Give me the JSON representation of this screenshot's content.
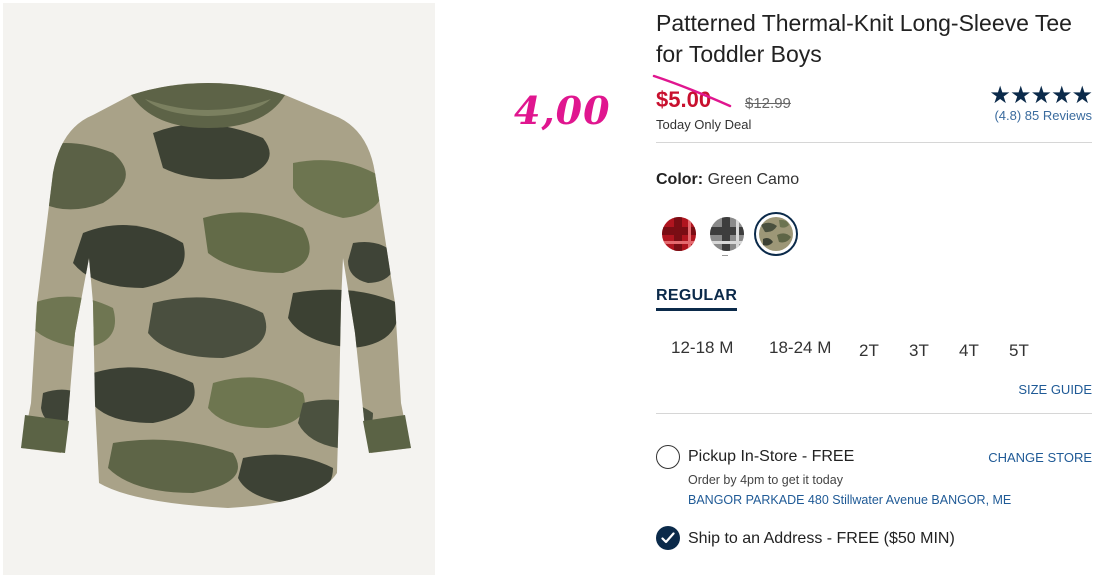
{
  "annotation": {
    "handwritten_price": "4,00"
  },
  "product": {
    "title": "Patterned Thermal-Knit Long-Sleeve Tee for Toddler Boys",
    "sale_price": "$5.00",
    "original_price": "$12.99",
    "deal_label": "Today Only Deal",
    "rating_stars": "★★★★★",
    "rating_value": "(4.8)",
    "review_count": "85 Reviews",
    "color_label": "Color:",
    "color_value": "Green Camo",
    "swatches": [
      {
        "name": "Red Plaid",
        "selected": false
      },
      {
        "name": "Gray Plaid",
        "selected": false
      },
      {
        "name": "Green Camo",
        "selected": true
      }
    ],
    "size_type": "REGULAR",
    "sizes": [
      "12-18 M",
      "18-24 M",
      "2T",
      "3T",
      "4T",
      "5T"
    ],
    "size_guide": "SIZE GUIDE"
  },
  "fulfillment": {
    "pickup_label": "Pickup In-Store - FREE",
    "change_store": "CHANGE STORE",
    "order_by": "Order by 4pm to get it today",
    "store_address": "BANGOR PARKADE 480 Stillwater Avenue  BANGOR, ME",
    "ship_label": "Ship to an Address - FREE ($50 MIN)",
    "selected_option": "ship"
  },
  "colors": {
    "sale_red": "#c8102e",
    "navy": "#0b2a4a",
    "link_blue": "#1f5a96",
    "annotation_pink": "#e0168f"
  }
}
